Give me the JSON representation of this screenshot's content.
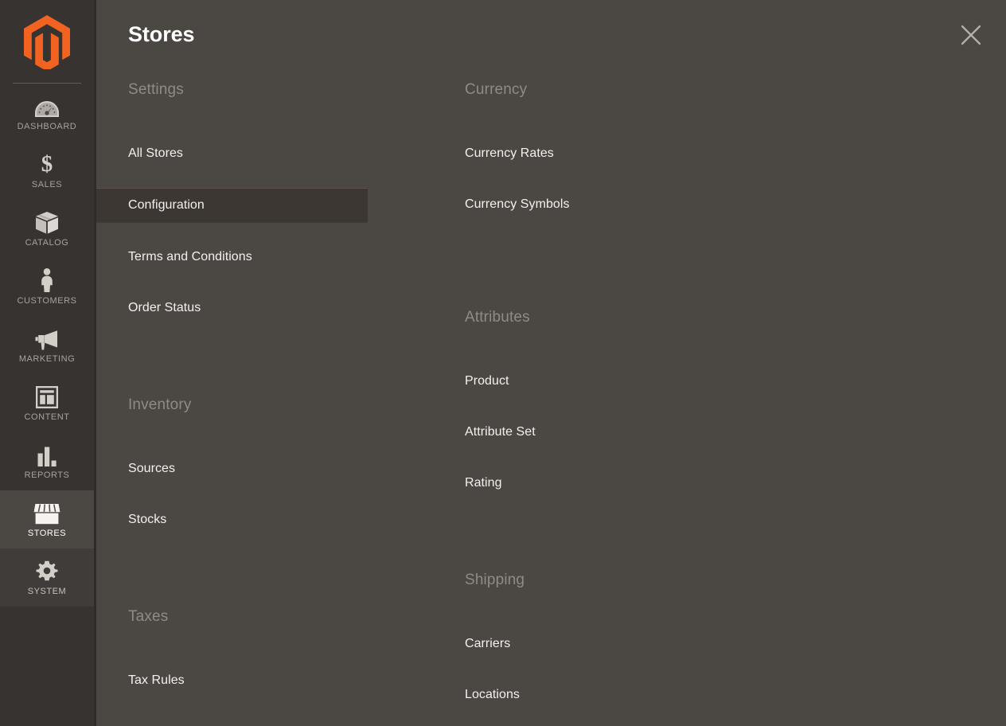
{
  "sidebar": {
    "logo": "magento-logo",
    "items": [
      {
        "label": "DASHBOARD",
        "icon": "gauge-icon",
        "state": "normal"
      },
      {
        "label": "SALES",
        "icon": "dollar-icon",
        "state": "normal"
      },
      {
        "label": "CATALOG",
        "icon": "box-icon",
        "state": "normal"
      },
      {
        "label": "CUSTOMERS",
        "icon": "person-icon",
        "state": "normal"
      },
      {
        "label": "MARKETING",
        "icon": "megaphone-icon",
        "state": "normal"
      },
      {
        "label": "CONTENT",
        "icon": "layout-icon",
        "state": "normal"
      },
      {
        "label": "REPORTS",
        "icon": "bar-chart-icon",
        "state": "normal"
      },
      {
        "label": "STORES",
        "icon": "storefront-icon",
        "state": "active"
      },
      {
        "label": "SYSTEM",
        "icon": "gear-icon",
        "state": "sub"
      }
    ]
  },
  "panel": {
    "title": "Stores",
    "close_icon": "close-icon",
    "columns": [
      {
        "groups": [
          {
            "title": "Settings",
            "items": [
              {
                "label": "All Stores",
                "highlight": false
              },
              {
                "label": "Configuration",
                "highlight": true
              },
              {
                "label": "Terms and Conditions",
                "highlight": false
              },
              {
                "label": "Order Status",
                "highlight": false
              }
            ]
          },
          {
            "title": "Inventory",
            "items": [
              {
                "label": "Sources",
                "highlight": false
              },
              {
                "label": "Stocks",
                "highlight": false
              }
            ]
          },
          {
            "title": "Taxes",
            "items": [
              {
                "label": "Tax Rules",
                "highlight": false
              }
            ]
          }
        ]
      },
      {
        "groups": [
          {
            "title": "Currency",
            "items": [
              {
                "label": "Currency Rates",
                "highlight": false
              },
              {
                "label": "Currency Symbols",
                "highlight": false
              }
            ]
          },
          {
            "title": "Attributes",
            "items": [
              {
                "label": "Product",
                "highlight": false
              },
              {
                "label": "Attribute Set",
                "highlight": false
              },
              {
                "label": "Rating",
                "highlight": false
              }
            ]
          },
          {
            "title": "Shipping",
            "items": [
              {
                "label": "Carriers",
                "highlight": false
              },
              {
                "label": "Locations",
                "highlight": false
              }
            ]
          }
        ]
      }
    ]
  },
  "colors": {
    "sidebar_bg": "#373330",
    "panel_bg": "#4b4844",
    "active_bg": "#4b4844",
    "highlight_bg": "#3c3733",
    "brand_orange": "#f26322",
    "label_muted": "#8f8a85",
    "text_primary": "#f3f0ee"
  }
}
